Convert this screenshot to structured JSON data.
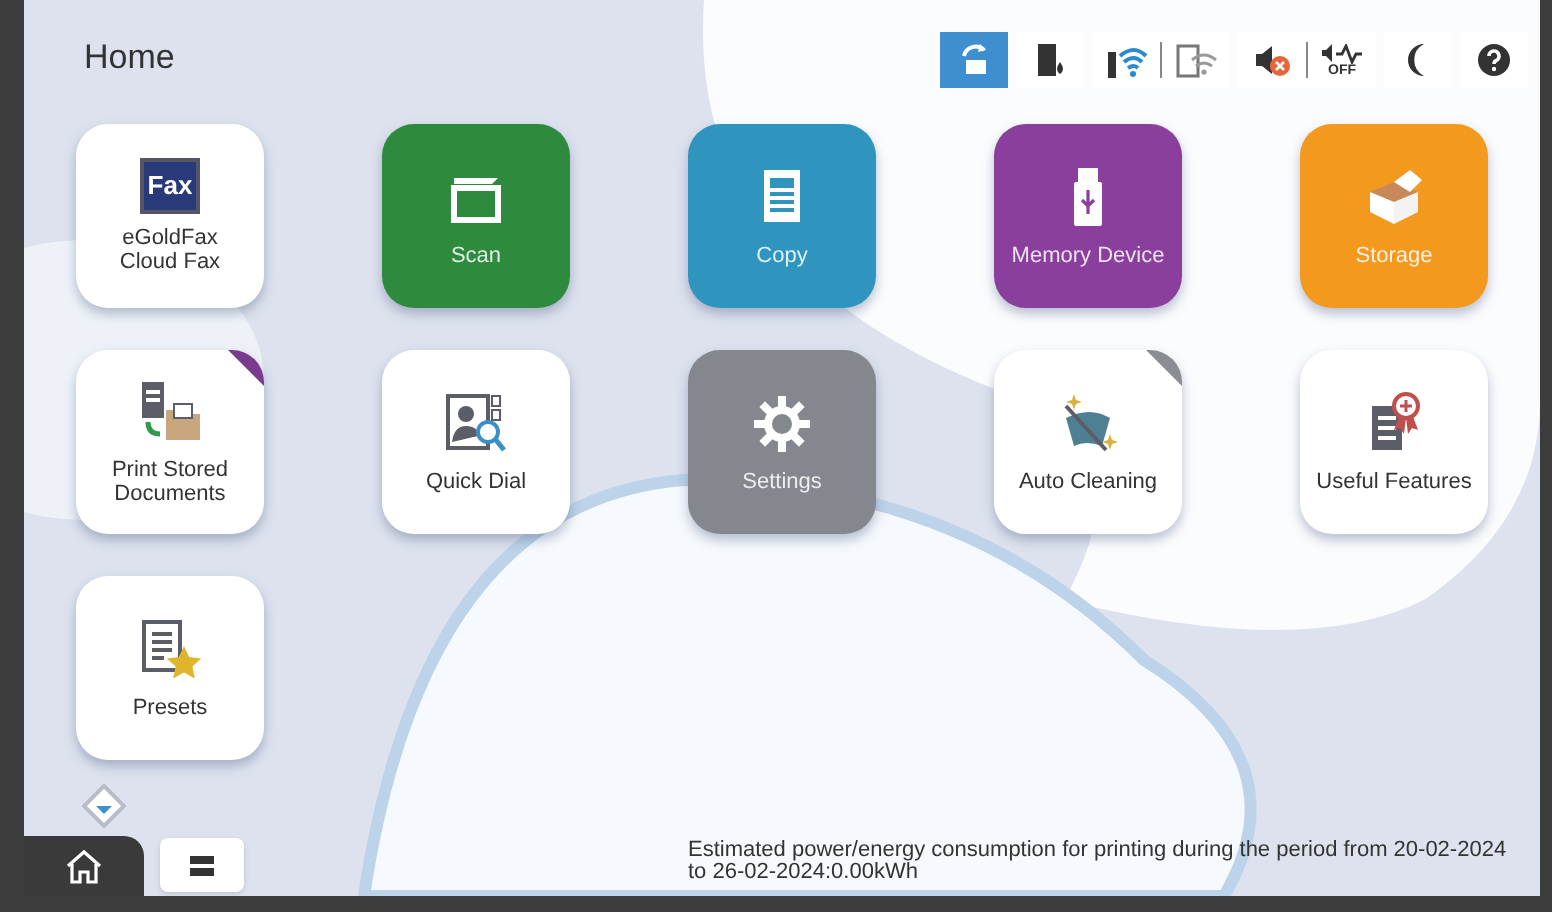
{
  "header": {
    "title": "Home"
  },
  "toolbar": [
    {
      "selected": true
    },
    {
      "selected": false
    },
    {
      "selected": false
    },
    {
      "selected": false
    },
    {
      "selected": false
    },
    {
      "selected": false,
      "label": "OFF"
    },
    {
      "selected": false
    },
    {
      "selected": false
    }
  ],
  "tiles": [
    {
      "label": "eGoldFax Cloud Fax",
      "kind": "white",
      "logo_text": "Fax"
    },
    {
      "label": "Scan",
      "kind": "filled",
      "color": "#2e8b3e"
    },
    {
      "label": "Copy",
      "kind": "filled",
      "color": "#2f94be"
    },
    {
      "label": "Memory Device",
      "kind": "filled",
      "color": "#8a3f9c"
    },
    {
      "label": "Storage",
      "kind": "filled",
      "color": "#f39a1e"
    },
    {
      "label": "Print Stored Documents",
      "kind": "white",
      "color": "#7a3b8f"
    },
    {
      "label": "Quick Dial",
      "kind": "white"
    },
    {
      "label": "Settings",
      "kind": "filled",
      "color": "#85878f"
    },
    {
      "label": "Auto Cleaning",
      "kind": "white",
      "color": "#8c8c94"
    },
    {
      "label": "Useful Features",
      "kind": "white"
    },
    {
      "label": "Presets",
      "kind": "white"
    }
  ],
  "bottom_tabs": [
    {
      "selected": true
    },
    {
      "selected": false
    }
  ],
  "energy_note": "Estimated power/energy consumption for printing during the period from 20-02-2024 to 26-02-2024:0.00kWh"
}
